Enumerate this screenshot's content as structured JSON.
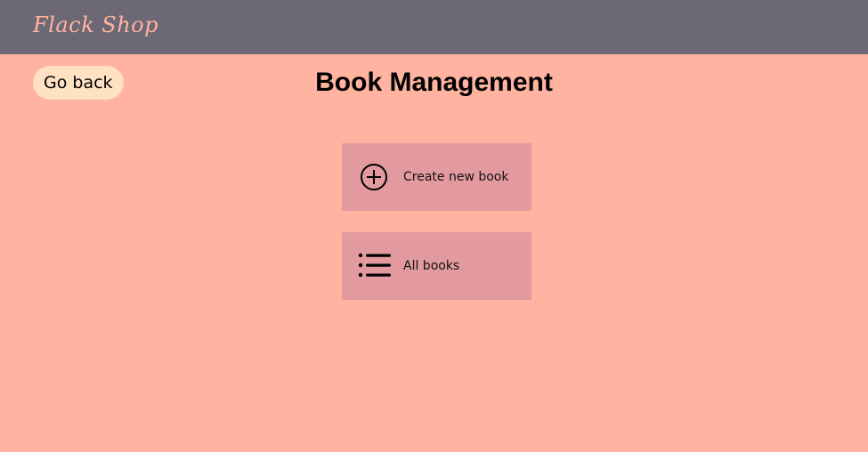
{
  "navbar": {
    "brand": "Flack Shop",
    "background_color": "#6D6875",
    "brand_color": "#FFB3A0"
  },
  "page": {
    "background_color": "#FFB3A0",
    "title": "Book Management",
    "back_button_label": "Go back",
    "back_button_color": "#FFE1C4"
  },
  "actions": [
    {
      "label": "Create new book",
      "icon": "plus-circle-icon"
    },
    {
      "label": "All books",
      "icon": "list-icon"
    }
  ],
  "card_color": "#E39A9F"
}
